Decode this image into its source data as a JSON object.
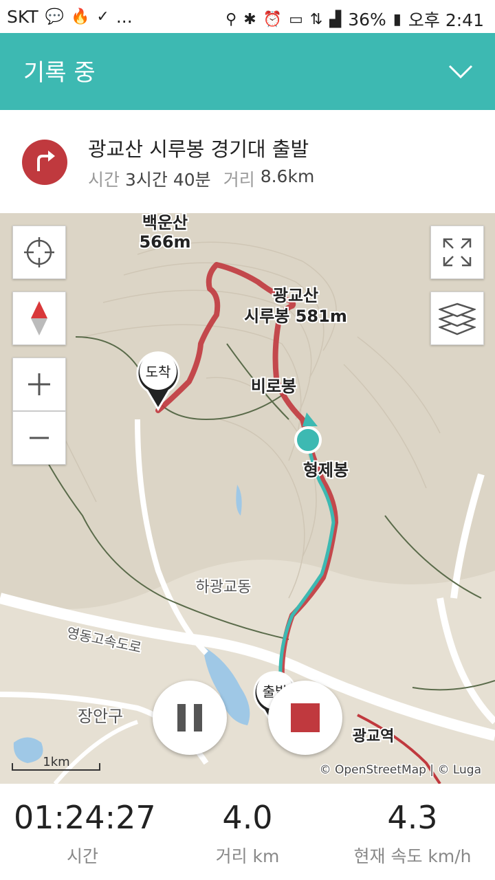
{
  "status": {
    "carrier": "SKT",
    "more": "...",
    "battery": "36%",
    "time": "오후 2:41"
  },
  "header": {
    "title": "기록 중"
  },
  "route": {
    "title": "광교산 시루봉 경기대 출발",
    "time_label": "시간",
    "time_value": "3시간 40분",
    "distance_label": "거리",
    "distance_value": "8.6km"
  },
  "map": {
    "labels": {
      "baegunsan_name": "백운산",
      "baegunsan_elev": "566m",
      "sirubong_1": "광교산",
      "sirubong_2": "시루봉 581m",
      "birobong": "비로봉",
      "hyeongjebong": "형제봉",
      "hagwanggyo": "하광교동",
      "expressway": "영동고속도로",
      "janganu": "장안구",
      "gwanggyo_station": "광교역",
      "finish_marker": "도착",
      "start_marker": "출발"
    },
    "scale": "1km",
    "attribution": "© OpenStreetMap | © Luga",
    "colors": {
      "planned_route": "#c0393e",
      "tracked_route": "#3db9b2"
    }
  },
  "controls": {
    "pause": "pause-icon",
    "stop": "stop-icon"
  },
  "stats": {
    "elapsed_value": "01:24:27",
    "elapsed_label": "시간",
    "distance_value": "4.0",
    "distance_label": "거리 km",
    "speed_value": "4.3",
    "speed_label": "현재 속도 km/h"
  }
}
